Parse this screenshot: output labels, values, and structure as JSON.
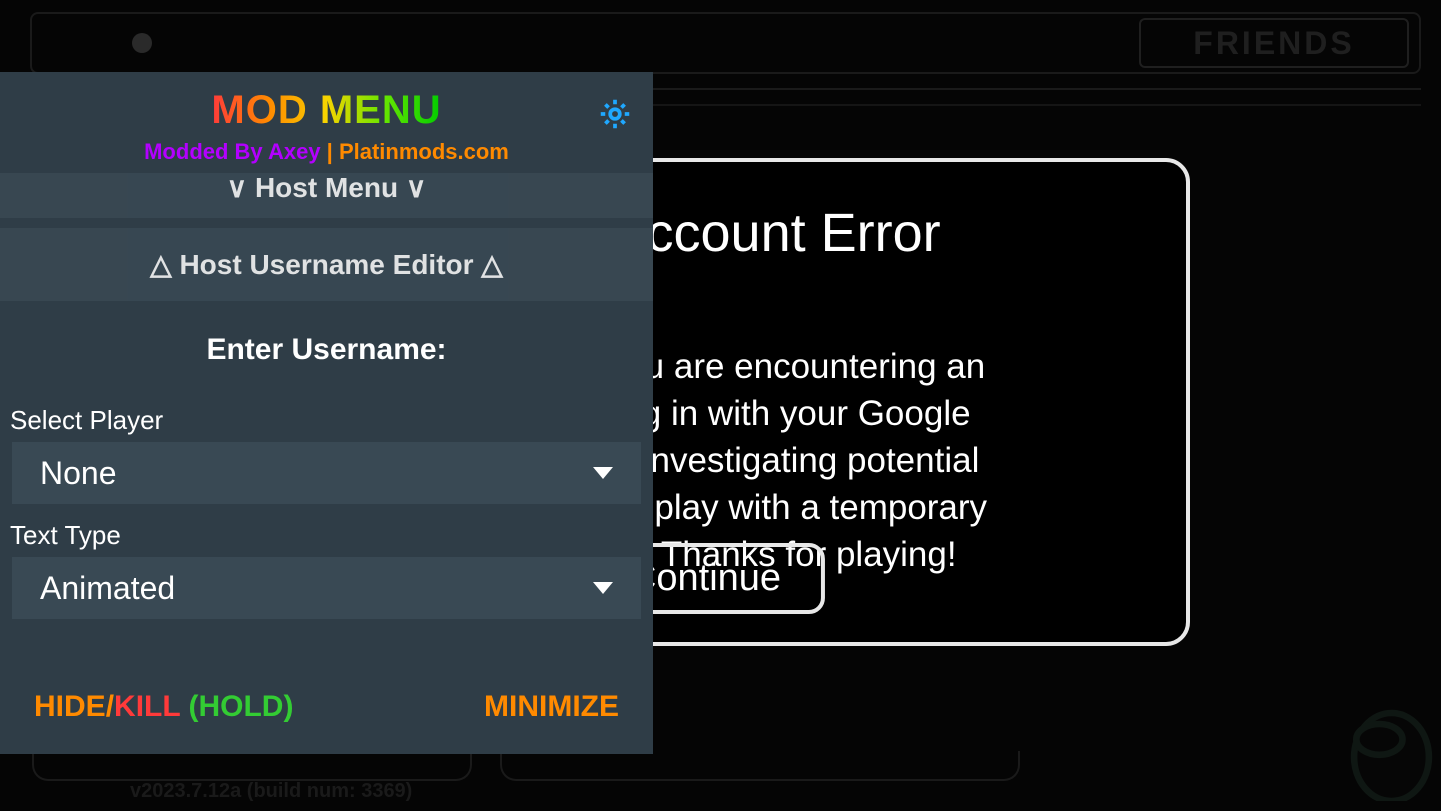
{
  "topbar": {
    "friends_label": "FRIENDS"
  },
  "error": {
    "title": "Store Account Error",
    "body": "ast update, you are encountering an\nu from logging in with your Google\ne that we are investigating potential\ne, you can still play with a temporary\ntures limited. Thanks for playing!",
    "continue_label": "Continue"
  },
  "mod": {
    "title": "MOD MENU",
    "subtitle_part1": "Modded By Axey",
    "subtitle_sep": " | ",
    "subtitle_part2": "Platinmods.com",
    "section_host_menu": "∨ Host Menu ∨",
    "section_username_editor": "△ Host Username Editor △",
    "enter_username_label": "Enter Username:",
    "select_player_label": "Select Player",
    "select_player_value": "None",
    "text_type_label": "Text Type",
    "text_type_value": "Animated",
    "footer_hide": "HIDE",
    "footer_slash": "/",
    "footer_kill": "KILL",
    "footer_hold": " (HOLD)",
    "footer_minimize": "MINIMIZE"
  },
  "version": "v2023.7.12a (build num: 3369)"
}
